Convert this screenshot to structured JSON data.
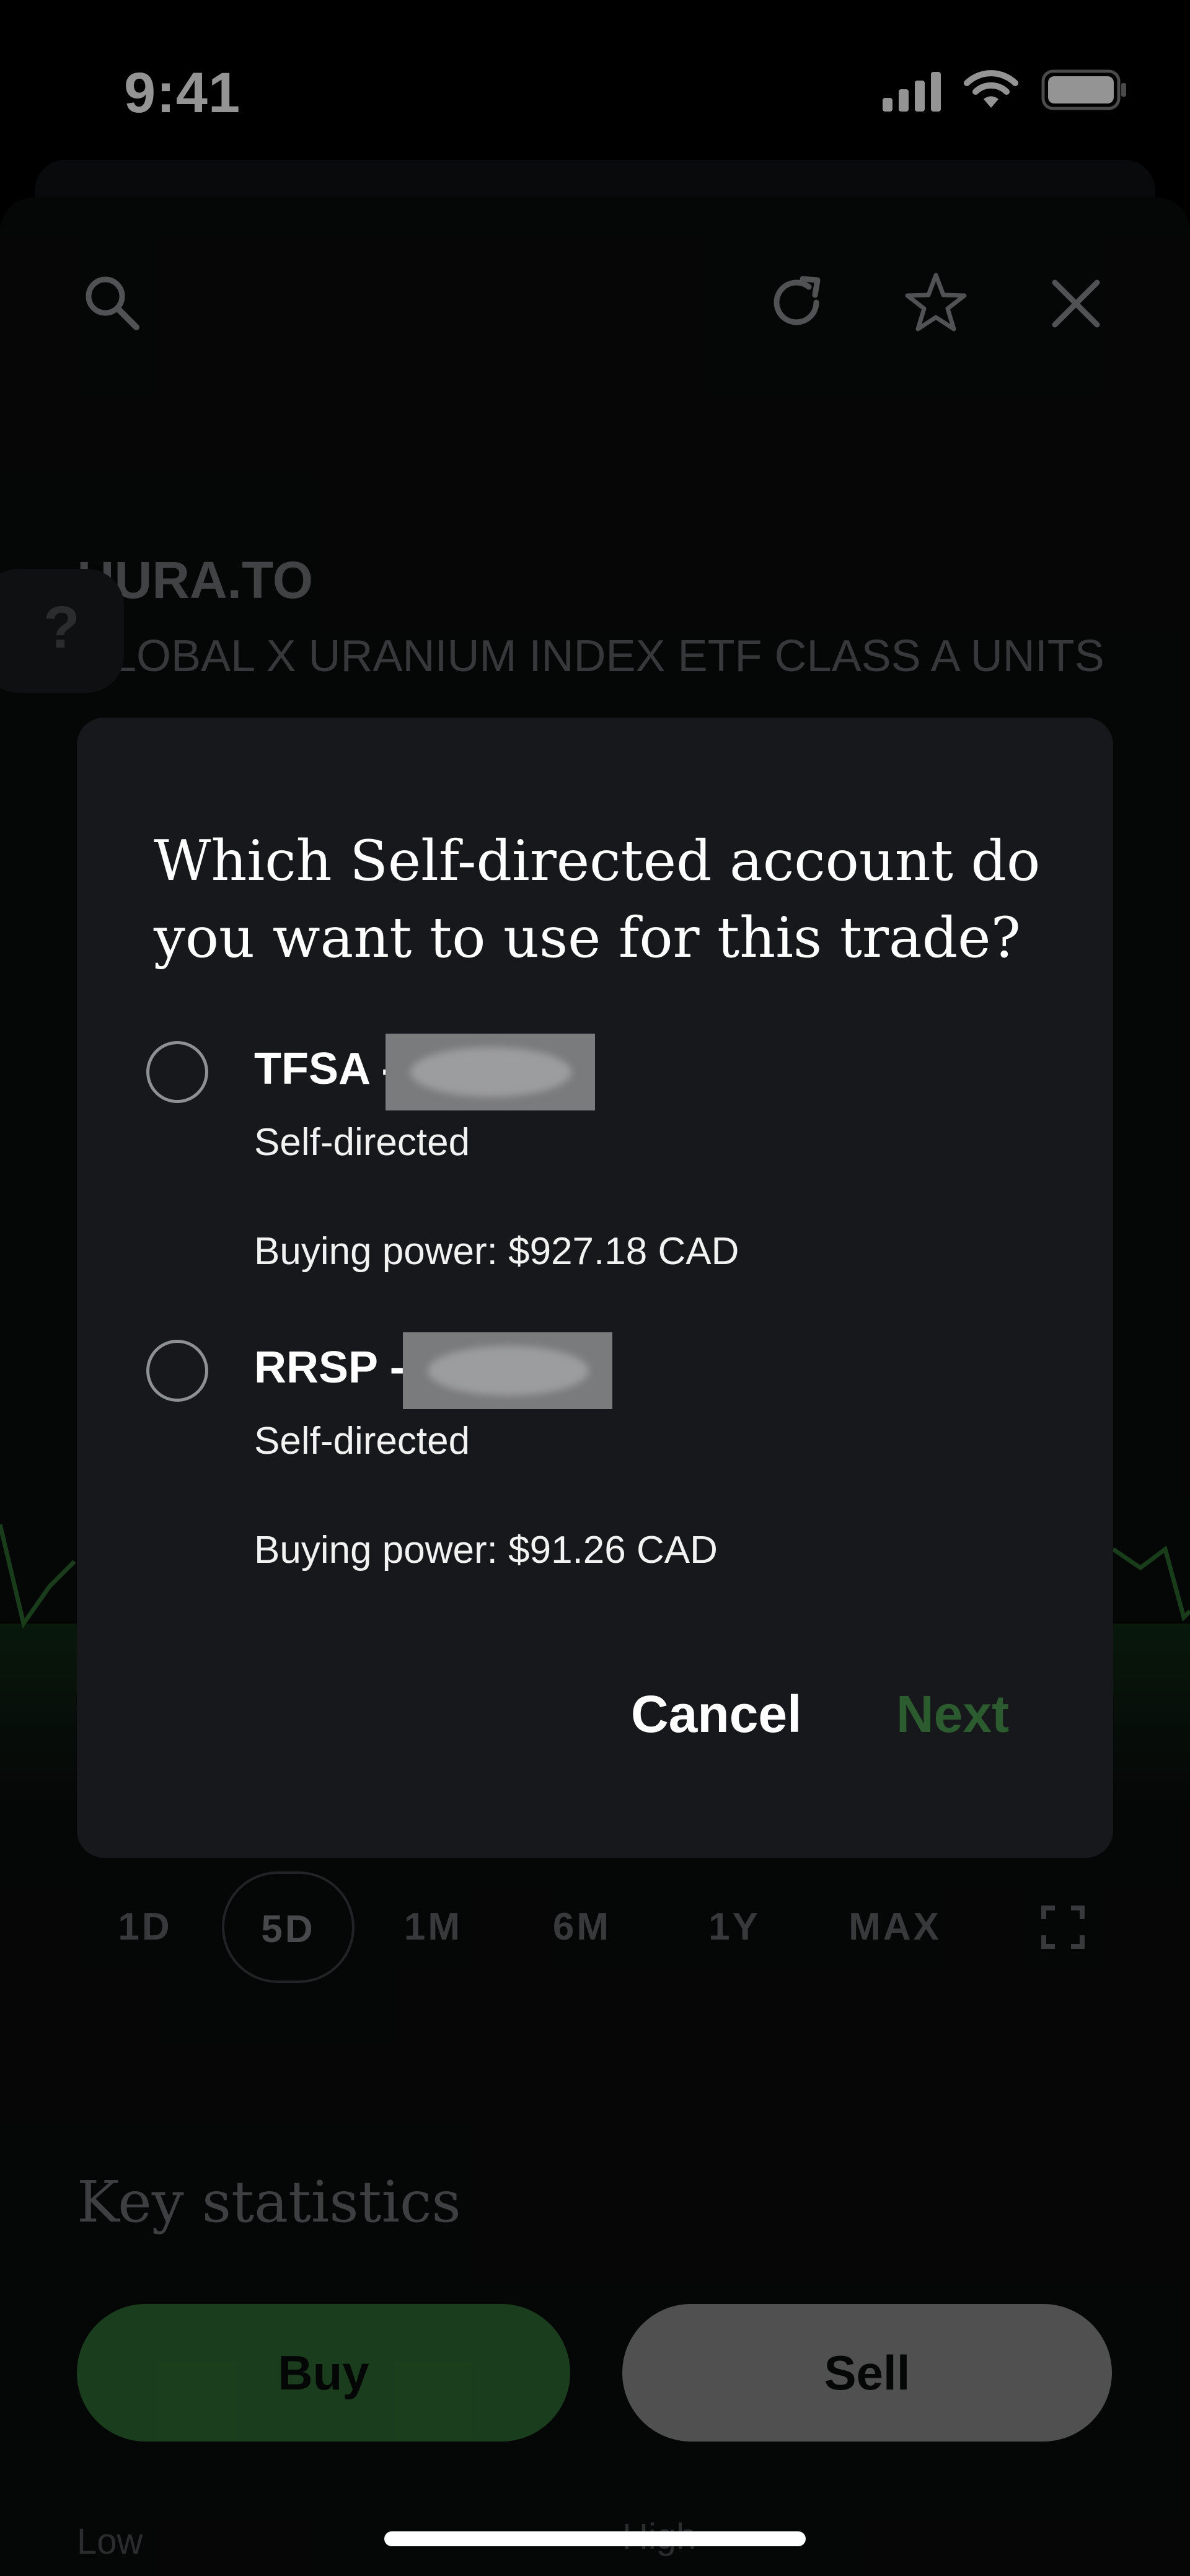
{
  "status_bar": {
    "time": "9:41"
  },
  "toolbar": {
    "icons": [
      "search-icon",
      "refresh-icon",
      "star-icon",
      "close-icon"
    ]
  },
  "security": {
    "ticker": "HURA.TO",
    "name": "GLOBAL X URANIUM INDEX ETF CLASS A UNITS"
  },
  "help_tab": {
    "label": "?"
  },
  "time_ranges": {
    "items": [
      "1D",
      "5D",
      "1M",
      "6M",
      "1Y",
      "MAX"
    ],
    "selected": "5D"
  },
  "key_statistics": {
    "title": "Key statistics",
    "low_label": "Low",
    "high_label": "High"
  },
  "actions": {
    "buy": "Buy",
    "sell": "Sell"
  },
  "dialog": {
    "title": "Which Self-directed account do you want to use for this trade?",
    "accounts": [
      {
        "name": "TFSA -",
        "type": "Self-directed",
        "buying_power": "Buying power: $927.18 CAD"
      },
      {
        "name": "RRSP -",
        "type": "Self-directed",
        "buying_power": "Buying power: $91.26 CAD"
      }
    ],
    "cancel_label": "Cancel",
    "next_label": "Next"
  },
  "colors": {
    "accent_green": "#2e6a32",
    "next_disabled": "#2b5b2e",
    "dialog_bg": "#17181b",
    "sell_gray": "#8a8a8a"
  }
}
